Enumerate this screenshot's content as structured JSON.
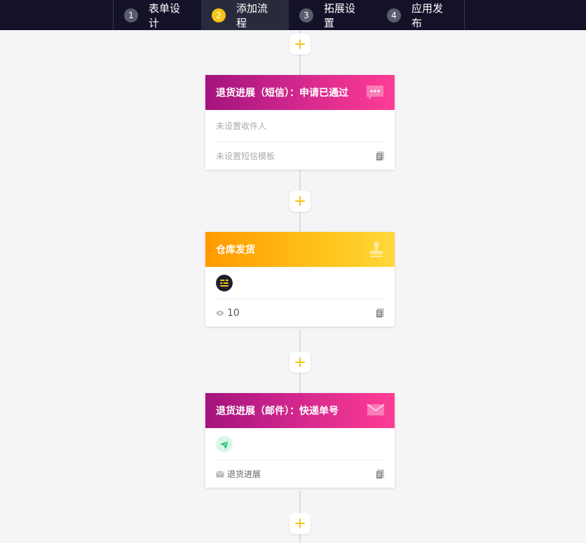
{
  "steps": [
    {
      "num": "1",
      "label": "表单设计"
    },
    {
      "num": "2",
      "label": "添加流程"
    },
    {
      "num": "3",
      "label": "拓展设置"
    },
    {
      "num": "4",
      "label": "应用发布"
    }
  ],
  "active_step": 2,
  "colors": {
    "topbar": "#141228",
    "accent": "#f5c518",
    "pink_start": "#a3137d",
    "pink_end": "#ff3d94",
    "orange_start": "#ff9a00",
    "orange_end": "#ffd83a"
  },
  "cards": [
    {
      "title": "退货进展（短信）：申请已通过",
      "icon": "sms-icon",
      "top_text": "未设置收件人",
      "bottom_text": "未设置短信模板"
    },
    {
      "title": "仓库发货",
      "icon": "stamp-icon",
      "avatar": "menu-avatar-icon",
      "views": "10"
    },
    {
      "title": "退货进展（邮件）：快递单号",
      "icon": "mail-icon",
      "avatar": "paper-plane-icon",
      "bottom_text": "退货进展"
    }
  ]
}
